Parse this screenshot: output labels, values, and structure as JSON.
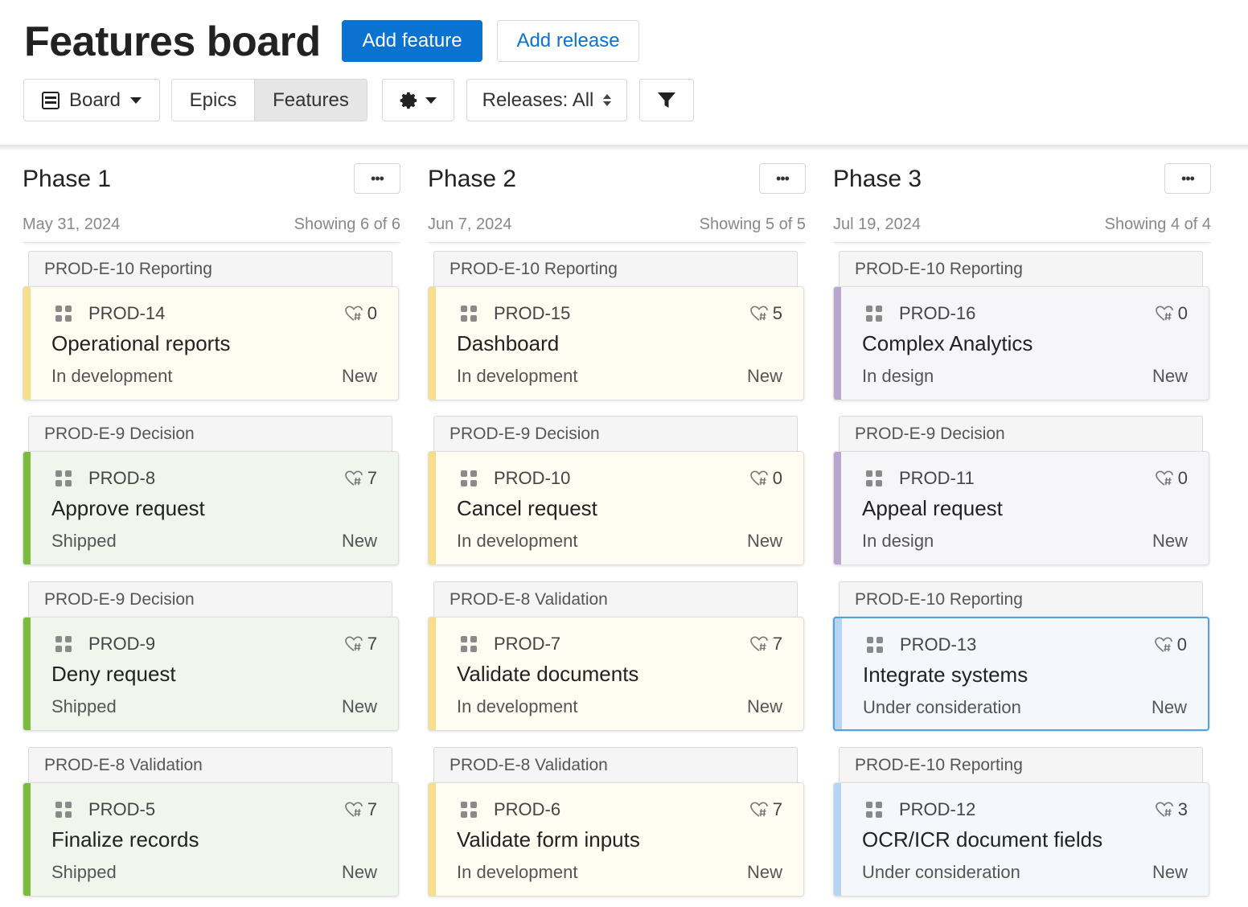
{
  "header": {
    "title": "Features board",
    "add_feature_label": "Add feature",
    "add_release_label": "Add release"
  },
  "toolbar": {
    "view_label": "Board",
    "segments": {
      "epics": "Epics",
      "features": "Features",
      "active": "Features"
    },
    "releases_label": "Releases: All",
    "icons": {
      "view": "board-icon",
      "settings": "gear-icon",
      "filter": "filter-icon"
    }
  },
  "colors": {
    "primary": "#0a73d1",
    "shipped_stripe": "#7bbb3f",
    "shipped_bg": "#f1f6ec",
    "development_stripe": "#f7df8a",
    "development_bg": "#fffcf2",
    "design_stripe": "#b8a6d1",
    "design_bg": "#f6f5f8",
    "consideration_stripe": "#b5d5f2",
    "consideration_bg": "#f4f8fc"
  },
  "columns": [
    {
      "title": "Phase 1",
      "date": "May 31, 2024",
      "count": "Showing 6 of 6",
      "cards": [
        {
          "epic": "PROD-E-10 Reporting",
          "id": "PROD-14",
          "score": "0",
          "name": "Operational reports",
          "status": "In development",
          "tag": "New",
          "stripe": "#f7df8a",
          "bg": "#fffcf2"
        },
        {
          "epic": "PROD-E-9 Decision",
          "id": "PROD-8",
          "score": "7",
          "name": "Approve request",
          "status": "Shipped",
          "tag": "New",
          "stripe": "#7bbb3f",
          "bg": "#f1f6ec"
        },
        {
          "epic": "PROD-E-9 Decision",
          "id": "PROD-9",
          "score": "7",
          "name": "Deny request",
          "status": "Shipped",
          "tag": "New",
          "stripe": "#7bbb3f",
          "bg": "#f1f6ec"
        },
        {
          "epic": "PROD-E-8 Validation",
          "id": "PROD-5",
          "score": "7",
          "name": "Finalize records",
          "status": "Shipped",
          "tag": "New",
          "stripe": "#7bbb3f",
          "bg": "#f1f6ec"
        }
      ]
    },
    {
      "title": "Phase 2",
      "date": "Jun 7, 2024",
      "count": "Showing 5 of 5",
      "cards": [
        {
          "epic": "PROD-E-10 Reporting",
          "id": "PROD-15",
          "score": "5",
          "name": "Dashboard",
          "status": "In development",
          "tag": "New",
          "stripe": "#f7df8a",
          "bg": "#fffcf2"
        },
        {
          "epic": "PROD-E-9 Decision",
          "id": "PROD-10",
          "score": "0",
          "name": "Cancel request",
          "status": "In development",
          "tag": "New",
          "stripe": "#f7df8a",
          "bg": "#fffcf2"
        },
        {
          "epic": "PROD-E-8 Validation",
          "id": "PROD-7",
          "score": "7",
          "name": "Validate documents",
          "status": "In development",
          "tag": "New",
          "stripe": "#f7df8a",
          "bg": "#fffcf2"
        },
        {
          "epic": "PROD-E-8 Validation",
          "id": "PROD-6",
          "score": "7",
          "name": "Validate form inputs",
          "status": "In development",
          "tag": "New",
          "stripe": "#f7df8a",
          "bg": "#fffcf2"
        }
      ]
    },
    {
      "title": "Phase 3",
      "date": "Jul 19, 2024",
      "count": "Showing 4 of 4",
      "cards": [
        {
          "epic": "PROD-E-10 Reporting",
          "id": "PROD-16",
          "score": "0",
          "name": "Complex Analytics",
          "status": "In design",
          "tag": "New",
          "stripe": "#b8a6d1",
          "bg": "#f6f5f8"
        },
        {
          "epic": "PROD-E-9 Decision",
          "id": "PROD-11",
          "score": "0",
          "name": "Appeal request",
          "status": "In design",
          "tag": "New",
          "stripe": "#b8a6d1",
          "bg": "#f6f5f8"
        },
        {
          "epic": "PROD-E-10 Reporting",
          "id": "PROD-13",
          "score": "0",
          "name": "Integrate systems",
          "status": "Under consideration",
          "tag": "New",
          "stripe": "#b5d5f2",
          "bg": "#f4f8fc",
          "selected": true
        },
        {
          "epic": "PROD-E-10 Reporting",
          "id": "PROD-12",
          "score": "3",
          "name": "OCR/ICR document fields",
          "status": "Under consideration",
          "tag": "New",
          "stripe": "#b5d5f2",
          "bg": "#f4f8fc"
        }
      ]
    }
  ]
}
